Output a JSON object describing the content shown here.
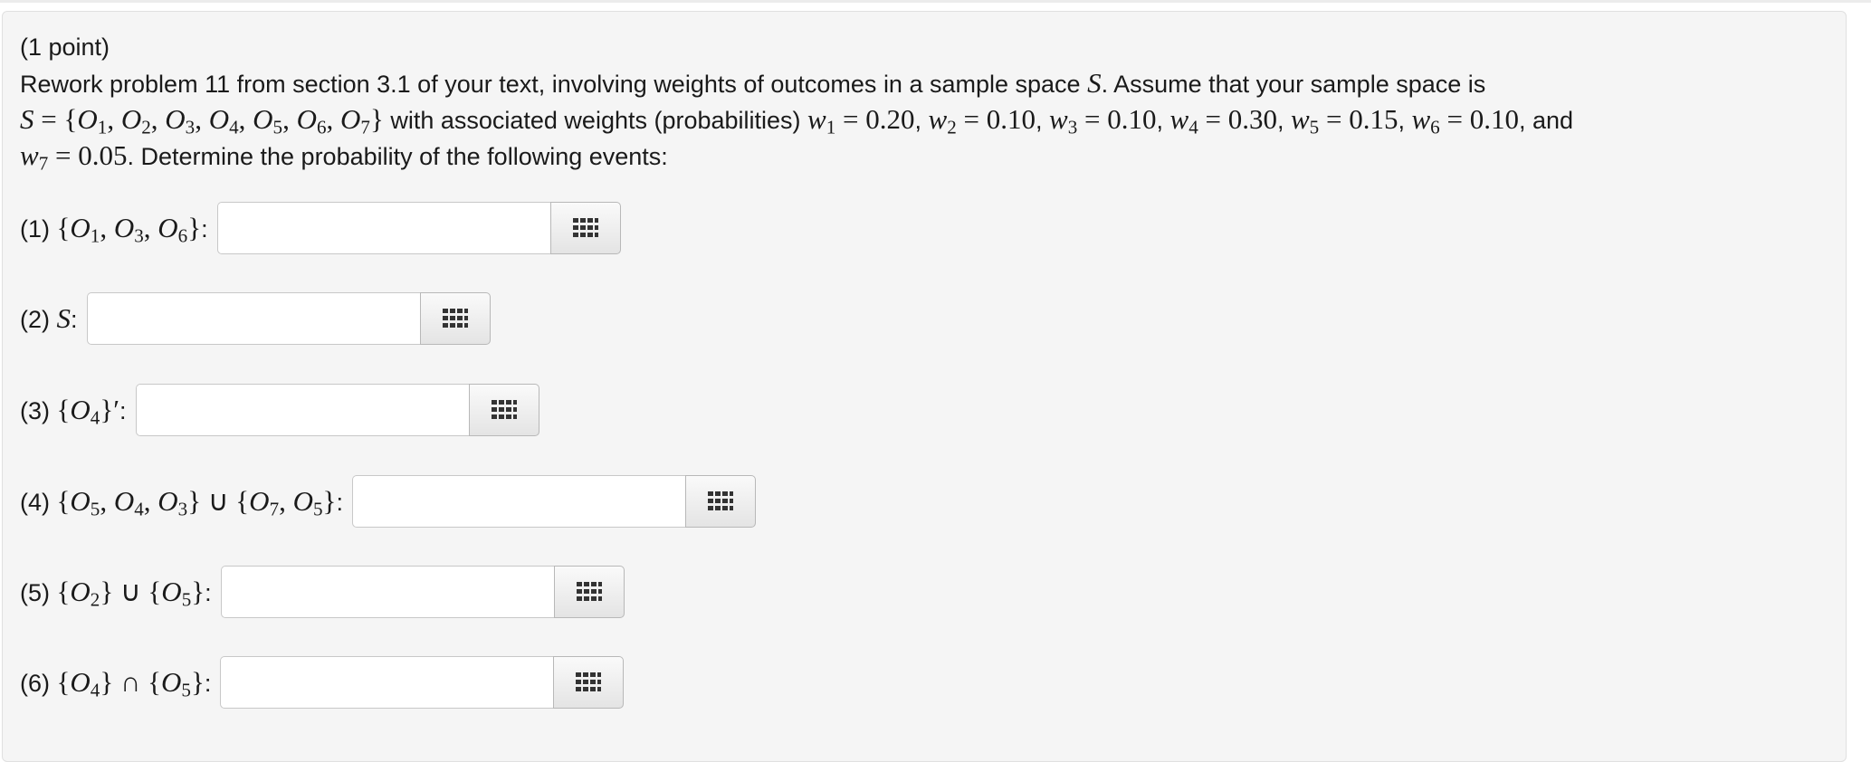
{
  "problem": {
    "points": "(1 point)",
    "intro_before": "Rework problem 11 from section 3.1 of your text, involving weights of outcomes in a sample space ",
    "space_symbol": "S",
    "intro_after": ". Assume that your sample space is",
    "set_def": "S = {O1, O2, O3, O4, O5, O6, O7}",
    "with_weights_text": " with associated weights (probabilities) ",
    "weights": [
      "0.20",
      "0.10",
      "0.10",
      "0.30",
      "0.15",
      "0.10",
      "0.05"
    ],
    "and_text": ", and",
    "determine_text": ". Determine the probability of the following events:"
  },
  "questions": [
    {
      "num": "(1)",
      "event": "{O1, O3, O6}",
      "answer": ""
    },
    {
      "num": "(2)",
      "event": "S",
      "answer": ""
    },
    {
      "num": "(3)",
      "event": "{O4}′",
      "answer": ""
    },
    {
      "num": "(4)",
      "event": "{O5, O4, O3} ∪ {O7, O5}",
      "answer": ""
    },
    {
      "num": "(5)",
      "event": "{O2} ∪ {O5}",
      "answer": ""
    },
    {
      "num": "(6)",
      "event": "{O4} ∩ {O5}",
      "answer": ""
    }
  ],
  "icons": {
    "palette": "grid-palette-icon"
  },
  "colors": {
    "panel_bg": "#f5f5f5",
    "input_border": "#c8c8c8",
    "text": "#1a1a1a"
  }
}
